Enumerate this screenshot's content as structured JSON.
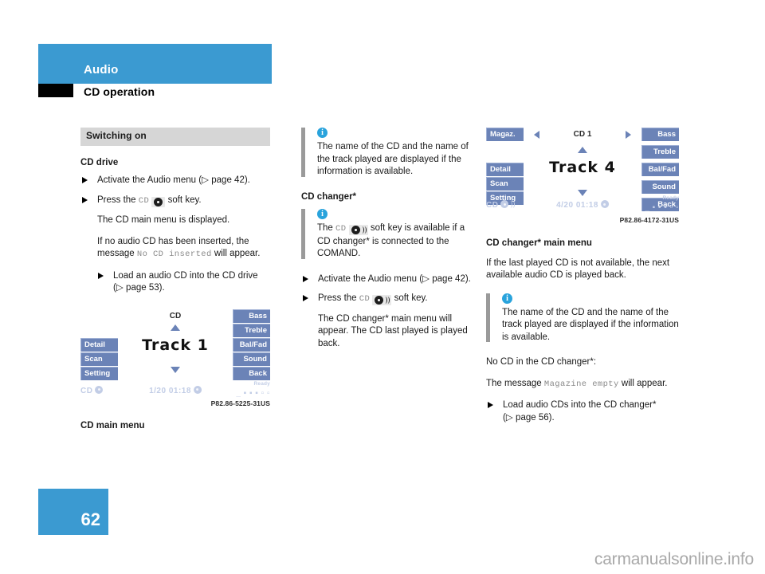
{
  "header": {
    "chapter": "Audio",
    "section": "CD operation",
    "accent_color": "#3b9ad1"
  },
  "page": {
    "number": "62",
    "watermark": "carmanualsonline.info"
  },
  "left_column": {
    "section_bar": "Switching on",
    "subhead": "CD drive",
    "bullet1": "Activate the Audio menu (",
    "bullet1_ref": "page 42).",
    "bullet2_pre": "Press the",
    "bullet2_key": "CD",
    "bullet2_post": "soft key.",
    "para1": "The CD main menu is displayed.",
    "para2_a": "If no audio CD has been inserted, the message",
    "para2_mono": "No CD inserted",
    "para2_b": "will appear.",
    "subbullet": "Load an audio CD into the CD drive",
    "subbullet_ref": "page 53).",
    "figure": {
      "left_buttons": [
        "Detail",
        "Scan",
        "Setting"
      ],
      "right_buttons": [
        "Bass",
        "Treble",
        "Bal/Fad",
        "Sound",
        "Back"
      ],
      "top_label": "CD",
      "track": "Track 1",
      "status_left": "CD",
      "status_mid": "1/20 01:18",
      "status_ready": "Ready",
      "status_bars": "_ ▪ ▪ ▪ ▫ ▫",
      "caption": "P82.86-5225-31US",
      "title": "CD main menu"
    }
  },
  "middle_column": {
    "info1": "The name of the CD and the name of the track played are displayed if the information is available.",
    "subhead": "CD changer*",
    "info2_a": "The",
    "info2_key": "CD",
    "info2_b": "soft key is available if a CD changer* is connected to the COMAND.",
    "bullet1": "Activate the Audio menu (",
    "bullet1_ref": "page 42).",
    "bullet2_pre": "Press the",
    "bullet2_key": "CD",
    "bullet2_post": "soft key.",
    "para1": "The CD changer* main menu will appear. The CD last played is played back."
  },
  "right_column": {
    "figure": {
      "left_buttons": [
        "Magaz.",
        "Detail",
        "Scan",
        "Setting"
      ],
      "right_buttons": [
        "Bass",
        "Treble",
        "Bal/Fad",
        "Sound",
        "Back"
      ],
      "top_label": "CD 1",
      "track": "Track 4",
      "status_left": "CD",
      "status_mid": "4/20 01:18",
      "status_ready": "Ready",
      "status_bars": "_ ▪ ▪ ▪ ▫ ▫",
      "caption": "P82.86-4172-31US"
    },
    "fig_title": "CD changer* main menu",
    "para1": "If the last played CD is not available, the next available audio CD is played back.",
    "info1": "The name of the CD and the name of the track played are displayed if the information is available.",
    "para2": "No CD in the CD changer*:",
    "para3_a": "The message",
    "para3_mono": "Magazine empty",
    "para3_b": "will appear.",
    "bullet1": "Load audio CDs into the CD changer*",
    "bullet1_ref": "page 56)."
  }
}
